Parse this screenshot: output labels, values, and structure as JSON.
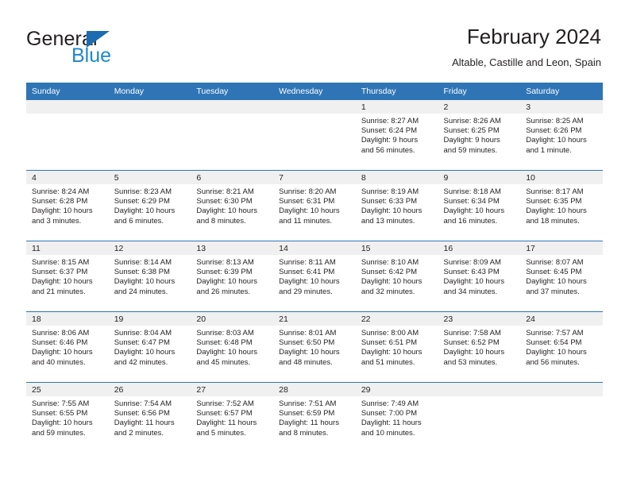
{
  "brand": {
    "word1": "General",
    "word2": "Blue",
    "triangle_color": "#1b6cb0",
    "blue_text_color": "#1f86d0"
  },
  "header": {
    "title": "February 2024",
    "subtitle": "Altable, Castille and Leon, Spain"
  },
  "theme": {
    "header_blue": "#2f75b5",
    "daynum_band": "#f0f0f0",
    "text": "#231f20"
  },
  "calendar": {
    "weekday_headers": [
      "Sunday",
      "Monday",
      "Tuesday",
      "Wednesday",
      "Thursday",
      "Friday",
      "Saturday"
    ],
    "weeks": [
      [
        {
          "day": "",
          "blank": true,
          "lines": [
            "",
            "",
            "",
            ""
          ]
        },
        {
          "day": "",
          "blank": true,
          "lines": [
            "",
            "",
            "",
            ""
          ]
        },
        {
          "day": "",
          "blank": true,
          "lines": [
            "",
            "",
            "",
            ""
          ]
        },
        {
          "day": "",
          "blank": true,
          "lines": [
            "",
            "",
            "",
            ""
          ]
        },
        {
          "day": "1",
          "blank": false,
          "lines": [
            "Sunrise: 8:27 AM",
            "Sunset: 6:24 PM",
            "Daylight: 9 hours",
            "and 56 minutes."
          ]
        },
        {
          "day": "2",
          "blank": false,
          "lines": [
            "Sunrise: 8:26 AM",
            "Sunset: 6:25 PM",
            "Daylight: 9 hours",
            "and 59 minutes."
          ]
        },
        {
          "day": "3",
          "blank": false,
          "lines": [
            "Sunrise: 8:25 AM",
            "Sunset: 6:26 PM",
            "Daylight: 10 hours",
            "and 1 minute."
          ]
        }
      ],
      [
        {
          "day": "4",
          "blank": false,
          "lines": [
            "Sunrise: 8:24 AM",
            "Sunset: 6:28 PM",
            "Daylight: 10 hours",
            "and 3 minutes."
          ]
        },
        {
          "day": "5",
          "blank": false,
          "lines": [
            "Sunrise: 8:23 AM",
            "Sunset: 6:29 PM",
            "Daylight: 10 hours",
            "and 6 minutes."
          ]
        },
        {
          "day": "6",
          "blank": false,
          "lines": [
            "Sunrise: 8:21 AM",
            "Sunset: 6:30 PM",
            "Daylight: 10 hours",
            "and 8 minutes."
          ]
        },
        {
          "day": "7",
          "blank": false,
          "lines": [
            "Sunrise: 8:20 AM",
            "Sunset: 6:31 PM",
            "Daylight: 10 hours",
            "and 11 minutes."
          ]
        },
        {
          "day": "8",
          "blank": false,
          "lines": [
            "Sunrise: 8:19 AM",
            "Sunset: 6:33 PM",
            "Daylight: 10 hours",
            "and 13 minutes."
          ]
        },
        {
          "day": "9",
          "blank": false,
          "lines": [
            "Sunrise: 8:18 AM",
            "Sunset: 6:34 PM",
            "Daylight: 10 hours",
            "and 16 minutes."
          ]
        },
        {
          "day": "10",
          "blank": false,
          "lines": [
            "Sunrise: 8:17 AM",
            "Sunset: 6:35 PM",
            "Daylight: 10 hours",
            "and 18 minutes."
          ]
        }
      ],
      [
        {
          "day": "11",
          "blank": false,
          "lines": [
            "Sunrise: 8:15 AM",
            "Sunset: 6:37 PM",
            "Daylight: 10 hours",
            "and 21 minutes."
          ]
        },
        {
          "day": "12",
          "blank": false,
          "lines": [
            "Sunrise: 8:14 AM",
            "Sunset: 6:38 PM",
            "Daylight: 10 hours",
            "and 24 minutes."
          ]
        },
        {
          "day": "13",
          "blank": false,
          "lines": [
            "Sunrise: 8:13 AM",
            "Sunset: 6:39 PM",
            "Daylight: 10 hours",
            "and 26 minutes."
          ]
        },
        {
          "day": "14",
          "blank": false,
          "lines": [
            "Sunrise: 8:11 AM",
            "Sunset: 6:41 PM",
            "Daylight: 10 hours",
            "and 29 minutes."
          ]
        },
        {
          "day": "15",
          "blank": false,
          "lines": [
            "Sunrise: 8:10 AM",
            "Sunset: 6:42 PM",
            "Daylight: 10 hours",
            "and 32 minutes."
          ]
        },
        {
          "day": "16",
          "blank": false,
          "lines": [
            "Sunrise: 8:09 AM",
            "Sunset: 6:43 PM",
            "Daylight: 10 hours",
            "and 34 minutes."
          ]
        },
        {
          "day": "17",
          "blank": false,
          "lines": [
            "Sunrise: 8:07 AM",
            "Sunset: 6:45 PM",
            "Daylight: 10 hours",
            "and 37 minutes."
          ]
        }
      ],
      [
        {
          "day": "18",
          "blank": false,
          "lines": [
            "Sunrise: 8:06 AM",
            "Sunset: 6:46 PM",
            "Daylight: 10 hours",
            "and 40 minutes."
          ]
        },
        {
          "day": "19",
          "blank": false,
          "lines": [
            "Sunrise: 8:04 AM",
            "Sunset: 6:47 PM",
            "Daylight: 10 hours",
            "and 42 minutes."
          ]
        },
        {
          "day": "20",
          "blank": false,
          "lines": [
            "Sunrise: 8:03 AM",
            "Sunset: 6:48 PM",
            "Daylight: 10 hours",
            "and 45 minutes."
          ]
        },
        {
          "day": "21",
          "blank": false,
          "lines": [
            "Sunrise: 8:01 AM",
            "Sunset: 6:50 PM",
            "Daylight: 10 hours",
            "and 48 minutes."
          ]
        },
        {
          "day": "22",
          "blank": false,
          "lines": [
            "Sunrise: 8:00 AM",
            "Sunset: 6:51 PM",
            "Daylight: 10 hours",
            "and 51 minutes."
          ]
        },
        {
          "day": "23",
          "blank": false,
          "lines": [
            "Sunrise: 7:58 AM",
            "Sunset: 6:52 PM",
            "Daylight: 10 hours",
            "and 53 minutes."
          ]
        },
        {
          "day": "24",
          "blank": false,
          "lines": [
            "Sunrise: 7:57 AM",
            "Sunset: 6:54 PM",
            "Daylight: 10 hours",
            "and 56 minutes."
          ]
        }
      ],
      [
        {
          "day": "25",
          "blank": false,
          "lines": [
            "Sunrise: 7:55 AM",
            "Sunset: 6:55 PM",
            "Daylight: 10 hours",
            "and 59 minutes."
          ]
        },
        {
          "day": "26",
          "blank": false,
          "lines": [
            "Sunrise: 7:54 AM",
            "Sunset: 6:56 PM",
            "Daylight: 11 hours",
            "and 2 minutes."
          ]
        },
        {
          "day": "27",
          "blank": false,
          "lines": [
            "Sunrise: 7:52 AM",
            "Sunset: 6:57 PM",
            "Daylight: 11 hours",
            "and 5 minutes."
          ]
        },
        {
          "day": "28",
          "blank": false,
          "lines": [
            "Sunrise: 7:51 AM",
            "Sunset: 6:59 PM",
            "Daylight: 11 hours",
            "and 8 minutes."
          ]
        },
        {
          "day": "29",
          "blank": false,
          "lines": [
            "Sunrise: 7:49 AM",
            "Sunset: 7:00 PM",
            "Daylight: 11 hours",
            "and 10 minutes."
          ]
        },
        {
          "day": "",
          "blank": true,
          "lines": [
            "",
            "",
            "",
            ""
          ]
        },
        {
          "day": "",
          "blank": true,
          "lines": [
            "",
            "",
            "",
            ""
          ]
        }
      ]
    ]
  }
}
